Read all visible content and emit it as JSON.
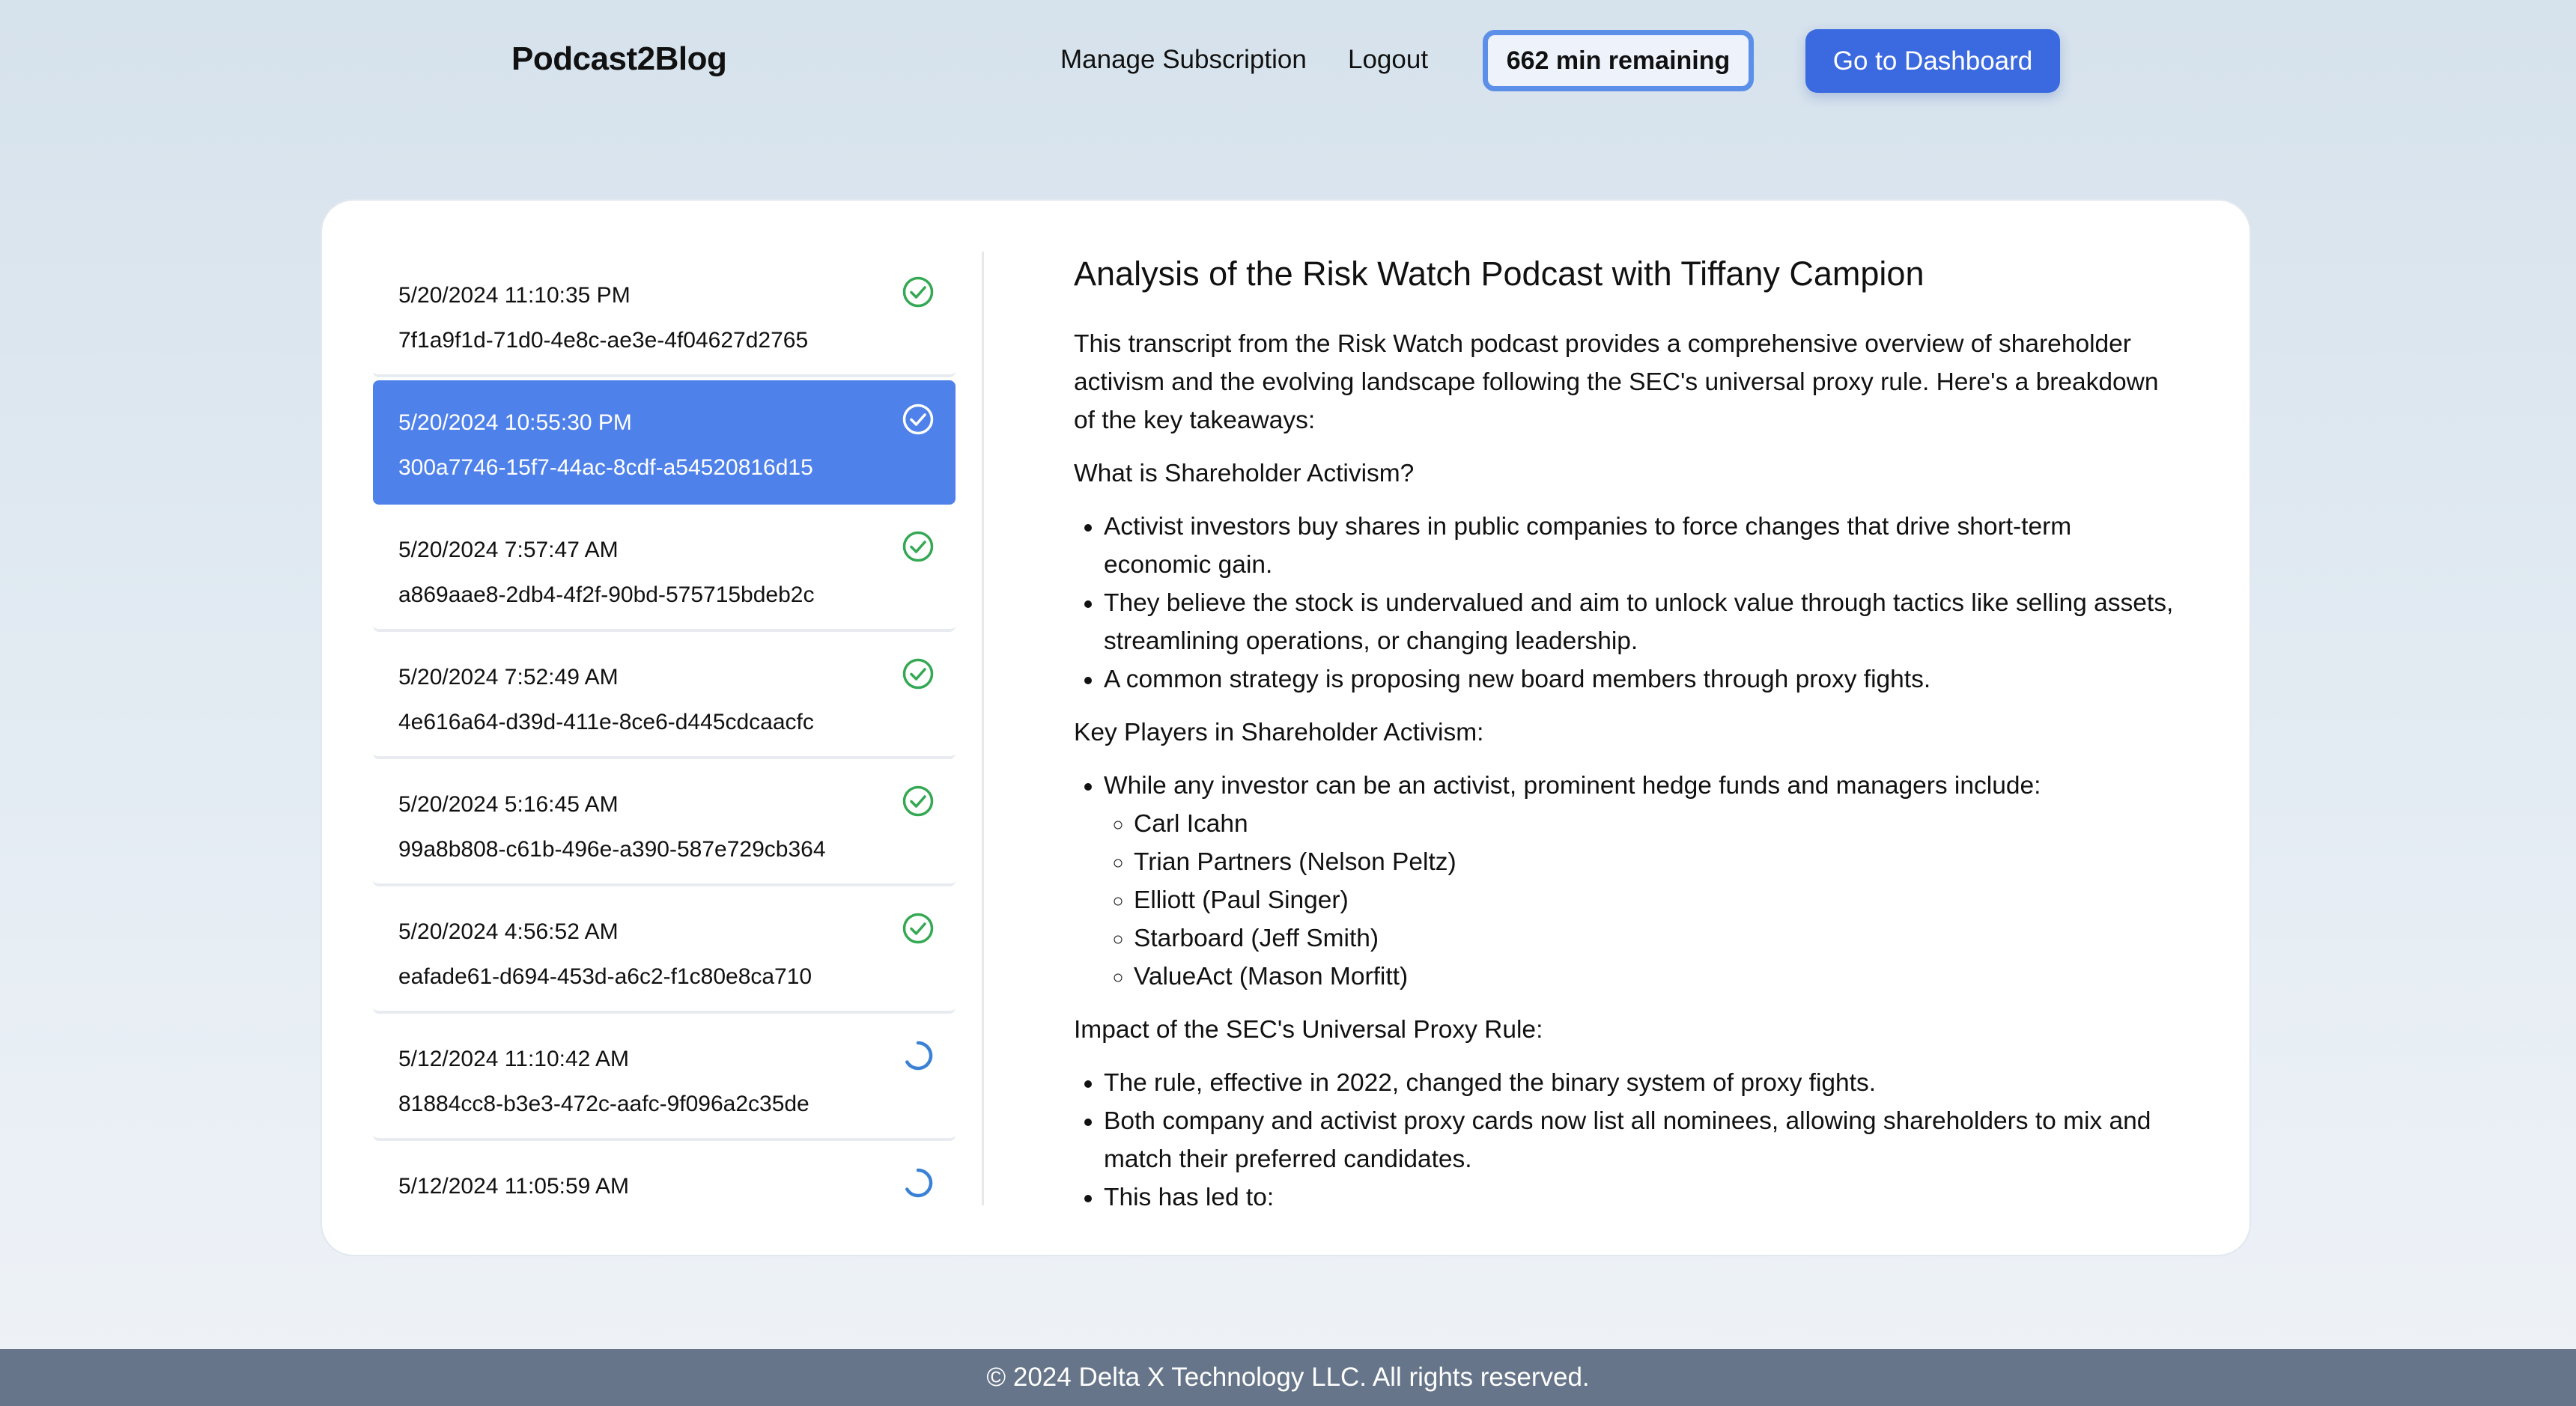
{
  "header": {
    "brand": "Podcast2Blog",
    "manage_subscription": "Manage Subscription",
    "logout": "Logout",
    "credits": "662 min remaining",
    "dashboard_button": "Go to Dashboard"
  },
  "colors": {
    "accent": "#3b6ae0",
    "selected_item": "#4f81ea",
    "done_status": "#34a853",
    "pending_status": "#3b82d6",
    "footer": "#667589"
  },
  "jobs": [
    {
      "date": "5/20/2024 11:10:35 PM",
      "id": "7f1a9f1d-71d0-4e8c-ae3e-4f04627d2765",
      "status": "done",
      "icon": "check-circle-icon",
      "selected": false
    },
    {
      "date": "5/20/2024 10:55:30 PM",
      "id": "300a7746-15f7-44ac-8cdf-a54520816d15",
      "status": "done",
      "icon": "check-circle-icon",
      "selected": true
    },
    {
      "date": "5/20/2024 7:57:47 AM",
      "id": "a869aae8-2db4-4f2f-90bd-575715bdeb2c",
      "status": "done",
      "icon": "check-circle-icon",
      "selected": false
    },
    {
      "date": "5/20/2024 7:52:49 AM",
      "id": "4e616a64-d39d-411e-8ce6-d445cdcaacfc",
      "status": "done",
      "icon": "check-circle-icon",
      "selected": false
    },
    {
      "date": "5/20/2024 5:16:45 AM",
      "id": "99a8b808-c61b-496e-a390-587e729cb364",
      "status": "done",
      "icon": "check-circle-icon",
      "selected": false
    },
    {
      "date": "5/20/2024 4:56:52 AM",
      "id": "eafade61-d694-453d-a6c2-f1c80e8ca710",
      "status": "done",
      "icon": "check-circle-icon",
      "selected": false
    },
    {
      "date": "5/12/2024 11:10:42 AM",
      "id": "81884cc8-b3e3-472c-aafc-9f096a2c35de",
      "status": "processing",
      "icon": "spinner-icon",
      "selected": false
    },
    {
      "date": "5/12/2024 11:05:59 AM",
      "id": "",
      "status": "processing",
      "icon": "spinner-icon",
      "selected": false
    }
  ],
  "article": {
    "title": "Analysis of the Risk Watch Podcast with Tiffany Campion",
    "intro": "This transcript from the Risk Watch podcast provides a comprehensive overview of shareholder activism and the evolving landscape following the SEC's universal proxy rule. Here's a breakdown of the key takeaways:",
    "section1_heading": "What is Shareholder Activism?",
    "section1_bullets": [
      "Activist investors buy shares in public companies to force changes that drive short-term economic gain.",
      "They believe the stock is undervalued and aim to unlock value through tactics like selling assets, streamlining operations, or changing leadership.",
      "A common strategy is proposing new board members through proxy fights."
    ],
    "section2_heading": "Key Players in Shareholder Activism:",
    "section2_bullet": "While any investor can be an activist, prominent hedge funds and managers include:",
    "section2_sub": [
      "Carl Icahn",
      "Trian Partners (Nelson Peltz)",
      "Elliott (Paul Singer)",
      "Starboard (Jeff Smith)",
      "ValueAct (Mason Morfitt)"
    ],
    "section3_heading": "Impact of the SEC's Universal Proxy Rule:",
    "section3_bullets": [
      "The rule, effective in 2022, changed the binary system of proxy fights.",
      "Both company and activist proxy cards now list all nominees, allowing shareholders to mix and match their preferred candidates.",
      "This has led to:"
    ]
  },
  "footer": {
    "copyright": "© 2024 Delta X Technology LLC. All rights reserved."
  }
}
